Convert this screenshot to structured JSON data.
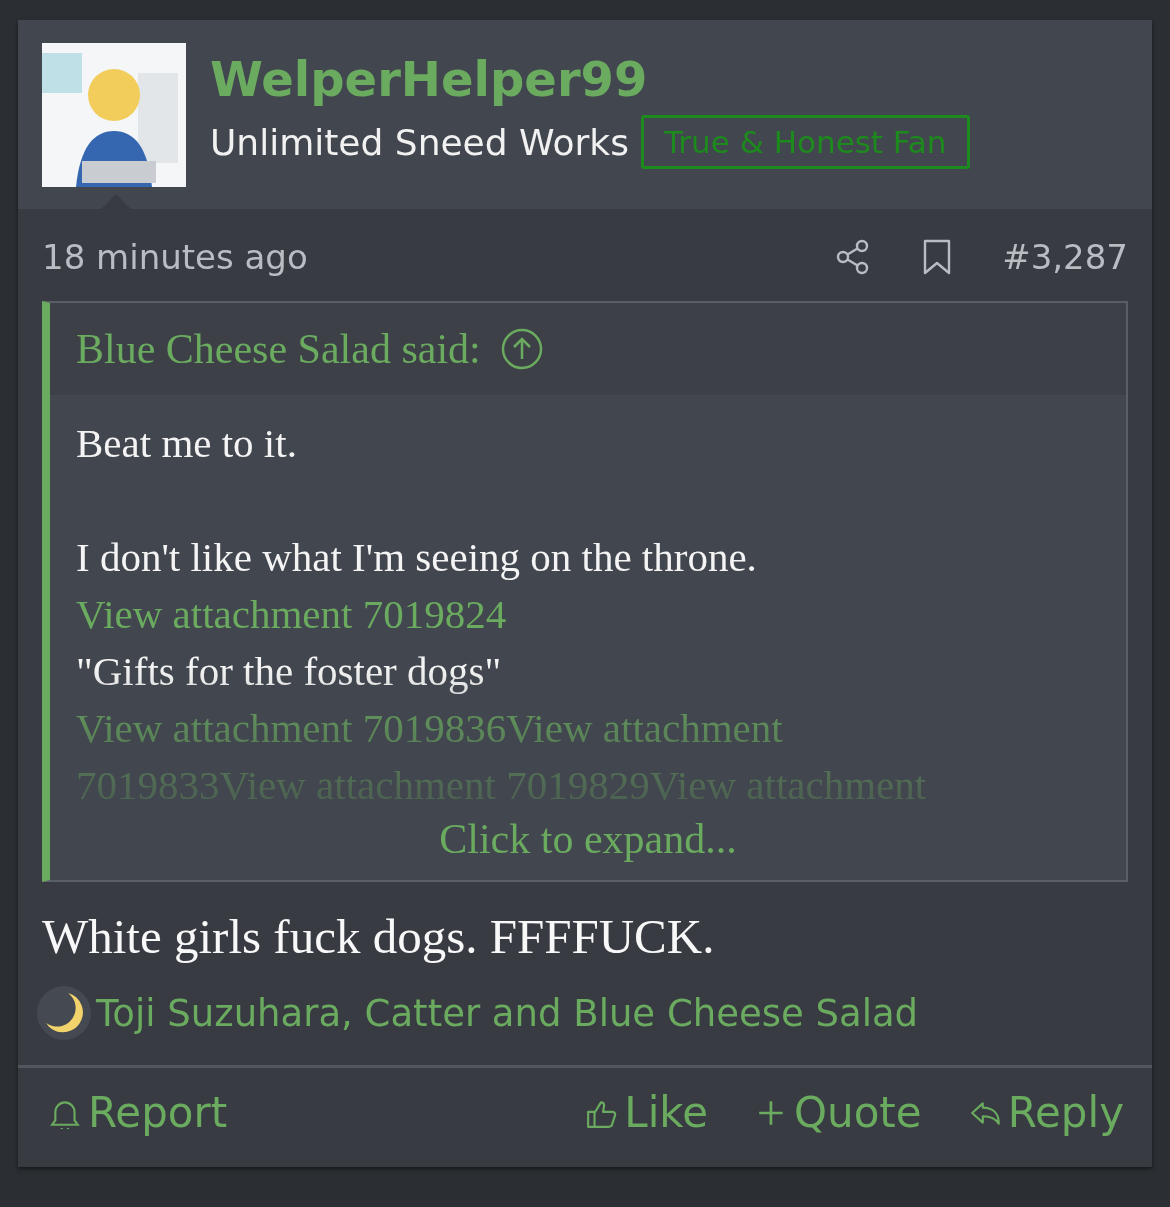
{
  "post": {
    "author": "WelperHelper99",
    "user_title": "Unlimited Sneed Works",
    "banner": "True & Honest Fan",
    "time": "18 minutes ago",
    "number": "#3,287",
    "quote": {
      "author_line": "Blue Cheese Salad said:",
      "collapsed": true,
      "expand": "Click to expand...",
      "paragraphs": [
        [
          {
            "kind": "text",
            "text": "Beat me to it."
          }
        ],
        [
          {
            "kind": "text",
            "text": "I don't like what I'm seeing on the throne."
          },
          {
            "kind": "link",
            "text": "View attachment 7019824"
          },
          {
            "kind": "text",
            "text": "\"Gifts for the foster dogs\""
          },
          {
            "kind": "link",
            "text": "View attachment 7019836View attachment"
          },
          {
            "kind": "link",
            "text": "7019833View attachment 7019829View attachment"
          }
        ]
      ]
    },
    "message": "White girls fuck dogs. FFFFUCK.",
    "reactions": "Toji Suzuhara, Catter and Blue Cheese Salad",
    "actions": [
      {
        "kind": "report",
        "label": "Report"
      },
      {
        "kind": "like",
        "label": "Like"
      },
      {
        "kind": "quote",
        "label": "Quote"
      },
      {
        "kind": "reply",
        "label": "Reply"
      }
    ]
  }
}
